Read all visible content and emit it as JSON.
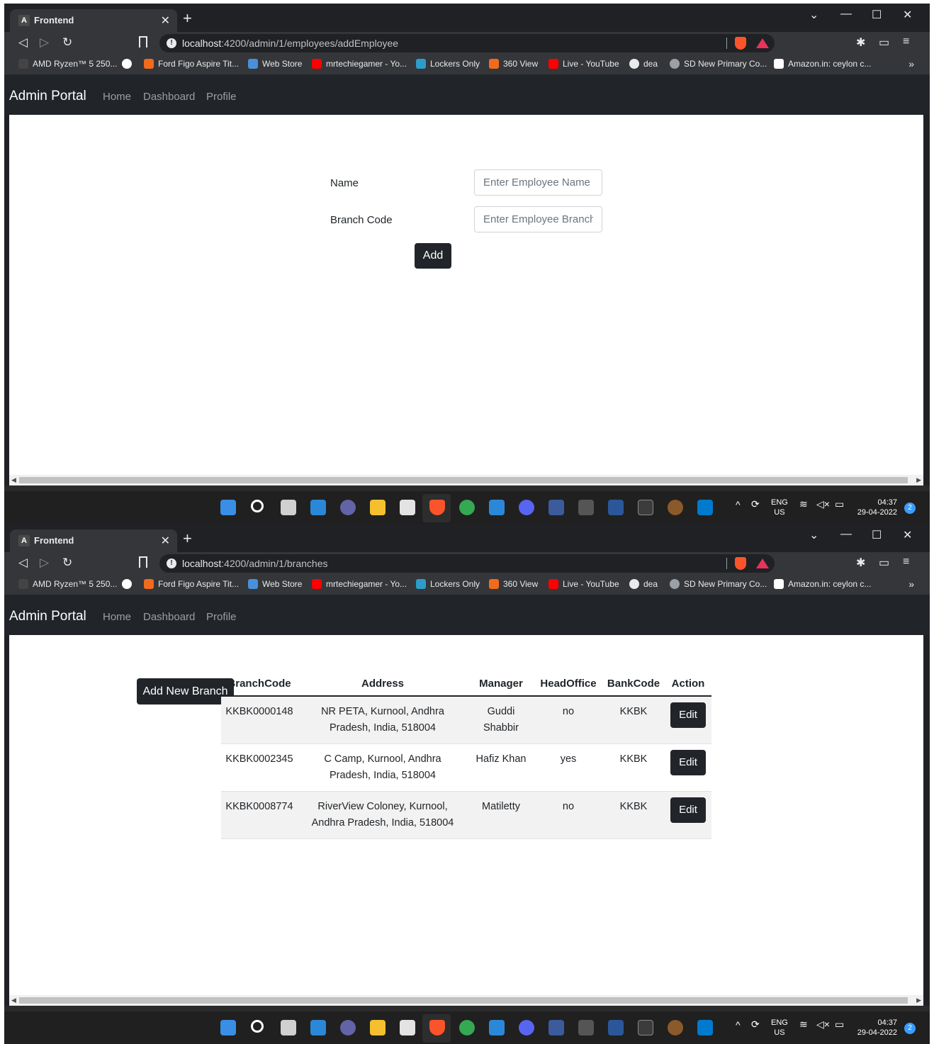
{
  "taskbar": {
    "lang_top": "ENG",
    "lang_bottom": "US",
    "time": "04:37",
    "date": "29-04-2022",
    "notification_count": "2"
  },
  "bookmarks": [
    "AMD Ryzen™ 5 250...",
    "Ford Figo Aspire Tit...",
    "Web Store",
    "mrtechiegamer - Yo...",
    "Lockers Only",
    "360 View",
    "Live - YouTube",
    "dea",
    "SD New Primary Co...",
    "Amazon.in: ceylon c..."
  ],
  "screen1": {
    "tab_title": "Frontend",
    "url_host": "localhost",
    "url_path": ":4200/admin/1/employees/addEmployee",
    "brand": "Admin Portal",
    "nav": [
      "Home",
      "Dashboard",
      "Profile"
    ],
    "form": {
      "name_label": "Name",
      "name_placeholder": "Enter Employee Name",
      "branch_label": "Branch Code",
      "branch_placeholder": "Enter Employee Branch",
      "add_button": "Add"
    }
  },
  "screen2": {
    "tab_title": "Frontend",
    "url_host": "localhost",
    "url_path": ":4200/admin/1/branches",
    "brand": "Admin Portal",
    "nav": [
      "Home",
      "Dashboard",
      "Profile"
    ],
    "add_branch_button": "Add New Branch",
    "table": {
      "headers": [
        "BranchCode",
        "Address",
        "Manager",
        "HeadOffice",
        "BankCode",
        "Action"
      ],
      "rows": [
        {
          "branch_code": "KKBK0000148",
          "address_1": "NR PETA, Kurnool, Andhra",
          "address_2": "Pradesh, India, 518004",
          "manager_1": "Guddi",
          "manager_2": "Shabbir",
          "head_office": "no",
          "bank_code": "KKBK",
          "action": "Edit"
        },
        {
          "branch_code": "KKBK0002345",
          "address_1": "C Camp, Kurnool, Andhra",
          "address_2": "Pradesh, India, 518004",
          "manager_1": "Hafiz Khan",
          "manager_2": "",
          "head_office": "yes",
          "bank_code": "KKBK",
          "action": "Edit"
        },
        {
          "branch_code": "KKBK0008774",
          "address_1": "RiverView Coloney, Kurnool,",
          "address_2": "Andhra Pradesh, India, 518004",
          "manager_1": "Matiletty",
          "manager_2": "",
          "head_office": "no",
          "bank_code": "KKBK",
          "action": "Edit"
        }
      ]
    }
  }
}
